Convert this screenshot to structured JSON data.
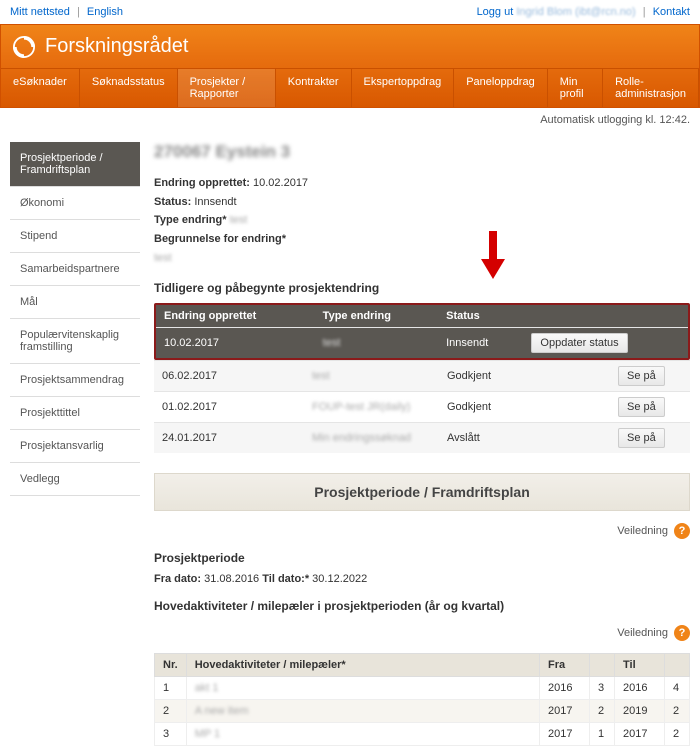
{
  "topbar": {
    "mitt_nettsted": "Mitt nettsted",
    "english": "English",
    "logg_ut": "Logg ut",
    "user_blur": "Ingrid Blom (ibt@rcn.no)",
    "kontakt": "Kontakt"
  },
  "brand": "Forskningsrådet",
  "tabs": [
    "eSøknader",
    "Søknadsstatus",
    "Prosjekter / Rapporter",
    "Kontrakter",
    "Ekspertoppdrag",
    "Paneloppdrag",
    "Min profil",
    "Rolle- administrasjon"
  ],
  "active_tab_index": 2,
  "auto_logout": "Automatisk utlogging kl. 12:42.",
  "sidebar": [
    "Prosjektperiode / Framdriftsplan",
    "Økonomi",
    "Stipend",
    "Samarbeidspartnere",
    "Mål",
    "Populærvitenskaplig framstilling",
    "Prosjektsammendrag",
    "Prosjekttittel",
    "Prosjektansvarlig",
    "Vedlegg"
  ],
  "active_side_index": 0,
  "project_title_blur": "270067  Eystein 3",
  "meta": {
    "endring_opprettet_label": "Endring opprettet:",
    "endring_opprettet_value": "10.02.2017",
    "status_label": "Status:",
    "status_value": "Innsendt",
    "type_endring_label": "Type endring*",
    "type_endring_value": "test",
    "begrunnelse_label": "Begrunnelse for endring*",
    "begrunnelse_value": "test"
  },
  "changes_title": "Tidligere og påbegynte prosjektendring",
  "changes_headers": {
    "date": "Endring opprettet",
    "type": "Type endring",
    "status": "Status"
  },
  "changes_rows": [
    {
      "date": "10.02.2017",
      "type": "test",
      "status": "Innsendt",
      "action": "Oppdater status",
      "highlight": true
    },
    {
      "date": "06.02.2017",
      "type": "test",
      "status": "Godkjent",
      "action": "Se på"
    },
    {
      "date": "01.02.2017",
      "type": "FOUP-test JR(daily)",
      "status": "Godkjent",
      "action": "Se på"
    },
    {
      "date": "24.01.2017",
      "type": "Min endringssøknad",
      "status": "Avslått",
      "action": "Se på"
    }
  ],
  "panel_title": "Prosjektperiode / Framdriftsplan",
  "help_label": "Veiledning",
  "period": {
    "title": "Prosjektperiode",
    "fra_label": "Fra dato:",
    "fra_value": "31.08.2016",
    "til_label": "Til dato:*",
    "til_value": "30.12.2022"
  },
  "milestones_title": "Hovedaktiviteter / milepæler i prosjektperioden (år og kvartal)",
  "ms_headers": {
    "nr": "Nr.",
    "name": "Hovedaktiviteter / milepæler*",
    "fra": "Fra",
    "til": "Til"
  },
  "ms_rows": [
    {
      "nr": "1",
      "name": "akt 1",
      "fra_y": "2016",
      "fra_q": "3",
      "til_y": "2016",
      "til_q": "4"
    },
    {
      "nr": "2",
      "name": "A new item",
      "fra_y": "2017",
      "fra_q": "2",
      "til_y": "2019",
      "til_q": "2"
    },
    {
      "nr": "3",
      "name": "MP 1",
      "fra_y": "2017",
      "fra_q": "1",
      "til_y": "2017",
      "til_q": "2"
    }
  ]
}
